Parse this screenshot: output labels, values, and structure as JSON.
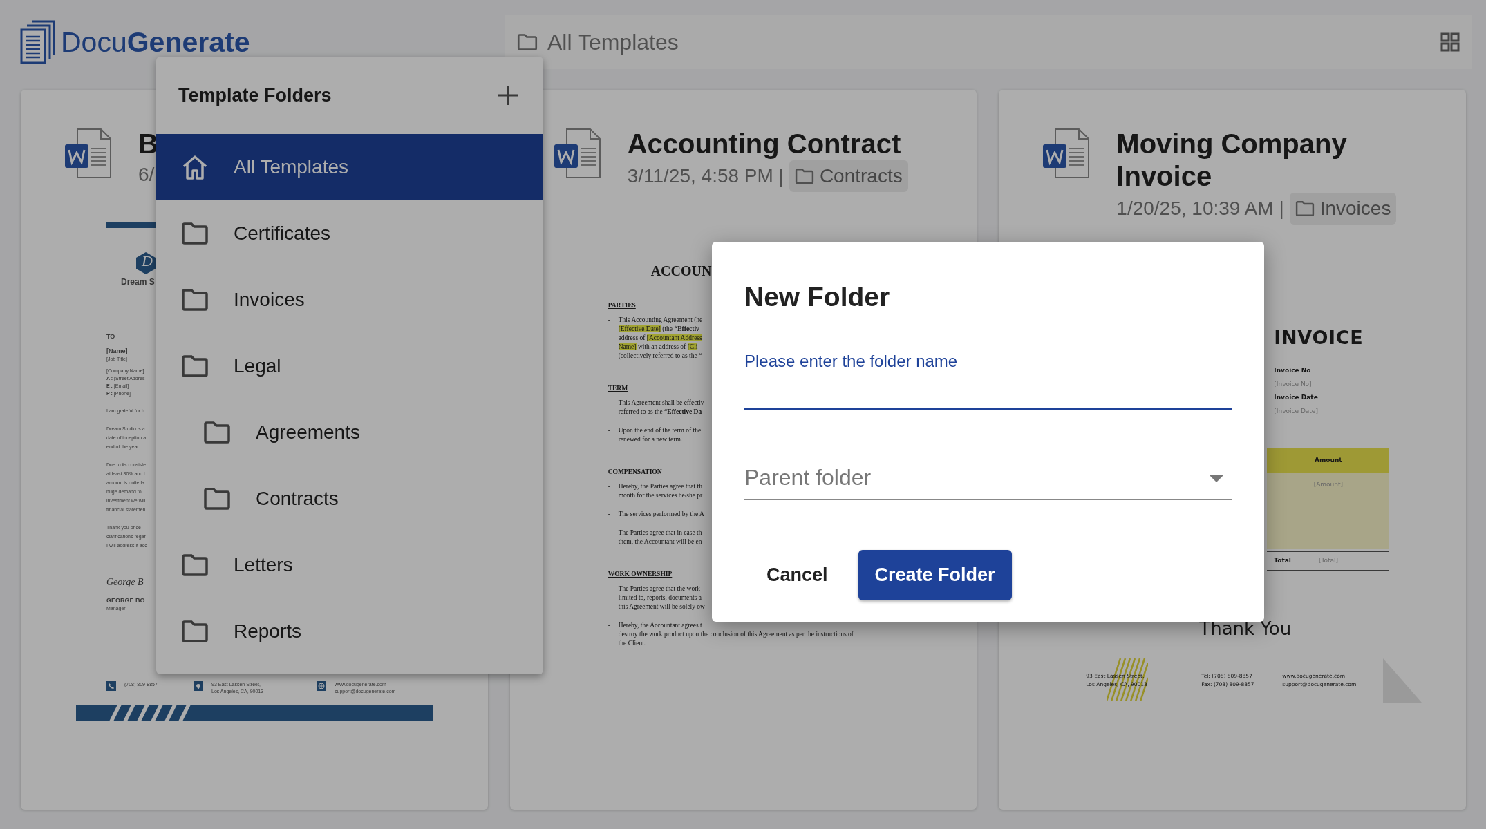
{
  "app": {
    "logo_prefix": "Docu",
    "logo_suffix": "Generate"
  },
  "toolbar": {
    "breadcrumb": "All Templates"
  },
  "templates": [
    {
      "title": "B",
      "date": "6/",
      "preview": {
        "kind": "letter",
        "brand_mark": "D",
        "brand": "Dream S",
        "to_label": "TO",
        "name": "[Name]",
        "job_title": "[Job Title]",
        "contact_lines": [
          "[Company Name]",
          "**A :** [Street Addres",
          "**E :** [Email]",
          "**P :** [Phone]"
        ],
        "paragraphs": [
          [
            "I am grateful for h"
          ],
          [
            "Dream Studio is a",
            "date of inception a",
            "end of the year."
          ],
          [
            "Due to its consiste",
            "at least 30% and t",
            "amount is quite la",
            "huge  demand  fo",
            "investment we will",
            "financial statemen"
          ],
          [
            "Thank  you  once",
            "clarifications regar",
            "I will address it acc"
          ]
        ],
        "signature": "George B",
        "signer": "GEORGE BO",
        "signer_role": "Manager",
        "footer": [
          {
            "kind": "phone",
            "lines": [
              "(708) 809-8857"
            ]
          },
          {
            "kind": "pin",
            "lines": [
              "93 East Lassen Street,",
              "Los Angeles, CA, 90013"
            ]
          },
          {
            "kind": "globe",
            "lines": [
              "www.docugenerate.com",
              "support@docugenerate.com"
            ]
          }
        ]
      }
    },
    {
      "title": "Accounting Contract",
      "date": "3/11/25, 4:58 PM |",
      "folder": "Contracts",
      "preview": {
        "kind": "contract",
        "title": "ACCOUN",
        "sections": [
          {
            "heading": "PARTIES",
            "items": [
              {
                "marker": "-",
                "lines": [
                  [
                    "This Accounting Agreement (he"
                  ],
                  [
                    {
                      "text": "[Effective Date]",
                      "highlight": true
                    },
                    {
                      "text": "  (the  **“Effectiv**",
                      "highlight": false
                    }
                  ],
                  [
                    {
                      "text": "address of ",
                      "highlight": false
                    },
                    {
                      "text": "[Accountant Address",
                      "highlight": true
                    }
                  ],
                  [
                    {
                      "text": "Name]",
                      "highlight": true
                    },
                    {
                      "text": "  with an address of  ",
                      "highlight": false
                    },
                    {
                      "text": "[Cli",
                      "highlight": true
                    }
                  ],
                  [
                    "(collectively referred to as the “"
                  ]
                ]
              }
            ]
          },
          {
            "heading": "TERM",
            "items": [
              {
                "marker": "-",
                "lines": [
                  [
                    "This Agreement shall be effectiv"
                  ],
                  [
                    "referred to as the “**Effective Da**"
                  ]
                ]
              },
              {
                "marker": "-",
                "lines": [
                  [
                    "Upon the end of the term of the"
                  ],
                  [
                    "renewed for a new term."
                  ]
                ]
              }
            ]
          },
          {
            "heading": "COMPENSATION",
            "items": [
              {
                "marker": "-",
                "lines": [
                  [
                    "Hereby, the Parties agree that th"
                  ],
                  [
                    "month for the services he/she pr"
                  ]
                ]
              },
              {
                "marker": "-",
                "lines": [
                  [
                    "The services performed by the A"
                  ]
                ]
              },
              {
                "marker": "-",
                "lines": [
                  [
                    "The Parties agree that in case th"
                  ],
                  [
                    "them, the Accountant will be en"
                  ]
                ]
              }
            ]
          },
          {
            "heading": "WORK OWNERSHIP",
            "items": [
              {
                "marker": "-",
                "lines": [
                  [
                    "The Parties agree that the work"
                  ],
                  [
                    "limited to, reports, documents a"
                  ],
                  [
                    "this Agreement will be solely ow"
                  ]
                ]
              },
              {
                "marker": "-",
                "lines": [
                  [
                    "Hereby, the Accountant agrees t"
                  ],
                  [
                    "destroy the work product upon the conclusion of this Agreement as per the instructions of"
                  ],
                  [
                    "the Client."
                  ]
                ]
              }
            ]
          }
        ]
      }
    },
    {
      "title": "Moving Company Invoice",
      "date": "1/20/25, 10:39 AM |",
      "folder": "Invoices",
      "preview": {
        "kind": "invoice",
        "title": "INVOICE",
        "fields": [
          {
            "label": "Invoice No",
            "value": "[Invoice No]"
          },
          {
            "label": "Invoice Date",
            "value": "[Invoice Date]"
          }
        ],
        "amount_header": "Amount",
        "amount_value": "[Amount]",
        "total_label": "Total",
        "total_value": "[Total]",
        "thanks": "Thank You",
        "footer": [
          [
            "93 East Lassen Street,",
            "Los Angeles, CA, 90013"
          ],
          [
            "Tel:  (708) 809-8857",
            "Fax:  (708) 809-8857"
          ],
          [
            "www.docugenerate.com",
            "support@docugenerate.com"
          ]
        ]
      }
    }
  ],
  "folders_menu": {
    "title": "Template Folders",
    "items": [
      {
        "label": "All Templates",
        "kind": "home",
        "selected": true
      },
      {
        "label": "Certificates",
        "kind": "folder",
        "selected": false
      },
      {
        "label": "Invoices",
        "kind": "folder",
        "selected": false
      },
      {
        "label": "Legal",
        "kind": "folder",
        "selected": false,
        "children": [
          {
            "label": "Agreements",
            "kind": "folder",
            "selected": false
          },
          {
            "label": "Contracts",
            "kind": "folder",
            "selected": false
          }
        ]
      },
      {
        "label": "Letters",
        "kind": "folder",
        "selected": false
      },
      {
        "label": "Reports",
        "kind": "folder",
        "selected": false
      }
    ]
  },
  "dialog": {
    "title": "New Folder",
    "name_field": {
      "label": "Please enter the folder name",
      "focused": true
    },
    "parent_select": {
      "placeholder": "Parent folder"
    },
    "buttons": [
      {
        "label": "Cancel",
        "kind": "text"
      },
      {
        "label": "Create Folder",
        "kind": "primary"
      }
    ]
  }
}
